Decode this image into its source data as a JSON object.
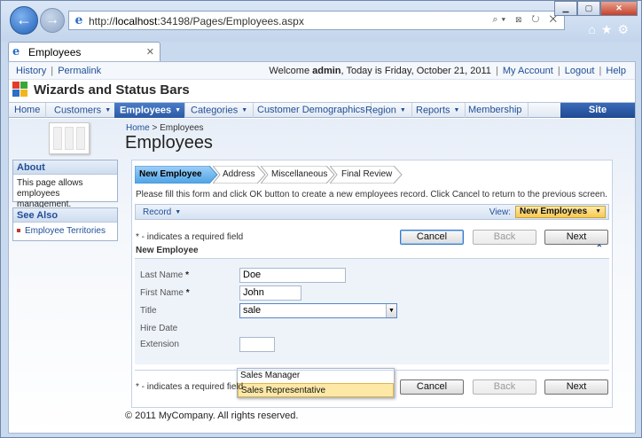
{
  "browser": {
    "url_prefix": "http://",
    "url_host": "localhost",
    "url_path": ":34198/Pages/Employees.aspx",
    "url_tools": "⌕▾ ⊠ ↻ ✕",
    "tab_title": "Employees",
    "tab_close": "✕",
    "back_glyph": "←",
    "forward_glyph": "→",
    "min_glyph": "▁",
    "max_glyph": "▢",
    "close_glyph": "✕",
    "home_glyph": "⌂",
    "fav_glyph": "★",
    "tools_glyph": "⚙"
  },
  "top": {
    "history": "History",
    "permalink": "Permalink",
    "welcome_prefix": "Welcome ",
    "user": "admin",
    "welcome_suffix": ", Today is Friday, October 21, 2011",
    "my_account": "My Account",
    "logout": "Logout",
    "help": "Help",
    "sep": "|"
  },
  "app_title": "Wizards and Status Bars",
  "menu": {
    "items": [
      "Home",
      "Customers",
      "Employees",
      "Categories",
      "Customer Demographics",
      "Region",
      "Reports",
      "Membership"
    ],
    "site_actions": "Site Actions"
  },
  "breadcrumb": {
    "home": "Home",
    "sep": ">",
    "current": "Employees"
  },
  "page_title": "Employees",
  "sidebar": {
    "about_title": "About",
    "about_text": "This page allows employees management.",
    "see_also_title": "See Also",
    "see_also_link": "Employee Territories"
  },
  "wizard": {
    "steps": [
      "New Employee",
      "Address",
      "Miscellaneous",
      "Final Review"
    ],
    "instructions": "Please fill this form and click OK button to create a new employees record. Click Cancel to return to the previous screen."
  },
  "actionbar": {
    "record": "Record",
    "view_label": "View:",
    "view_value": "New Employees"
  },
  "form": {
    "required_note": "* - indicates a required field",
    "section_title": "New Employee",
    "collapse_glyph": "⌃",
    "cancel": "Cancel",
    "back": "Back",
    "next": "Next",
    "star": "*",
    "fields": {
      "last_name_label": "Last Name",
      "last_name_value": "Doe",
      "first_name_label": "First Name",
      "first_name_value": "John",
      "title_label": "Title",
      "title_value": "sale",
      "hire_date_label": "Hire Date",
      "extension_label": "Extension"
    },
    "suggestions": [
      "Sales Manager",
      "Sales Representative"
    ]
  },
  "footer": "© 2011 MyCompany. All rights reserved.",
  "colors": {
    "accent": "#2b5aa5",
    "link": "#1f4f97",
    "highlight": "#fde8a6"
  }
}
